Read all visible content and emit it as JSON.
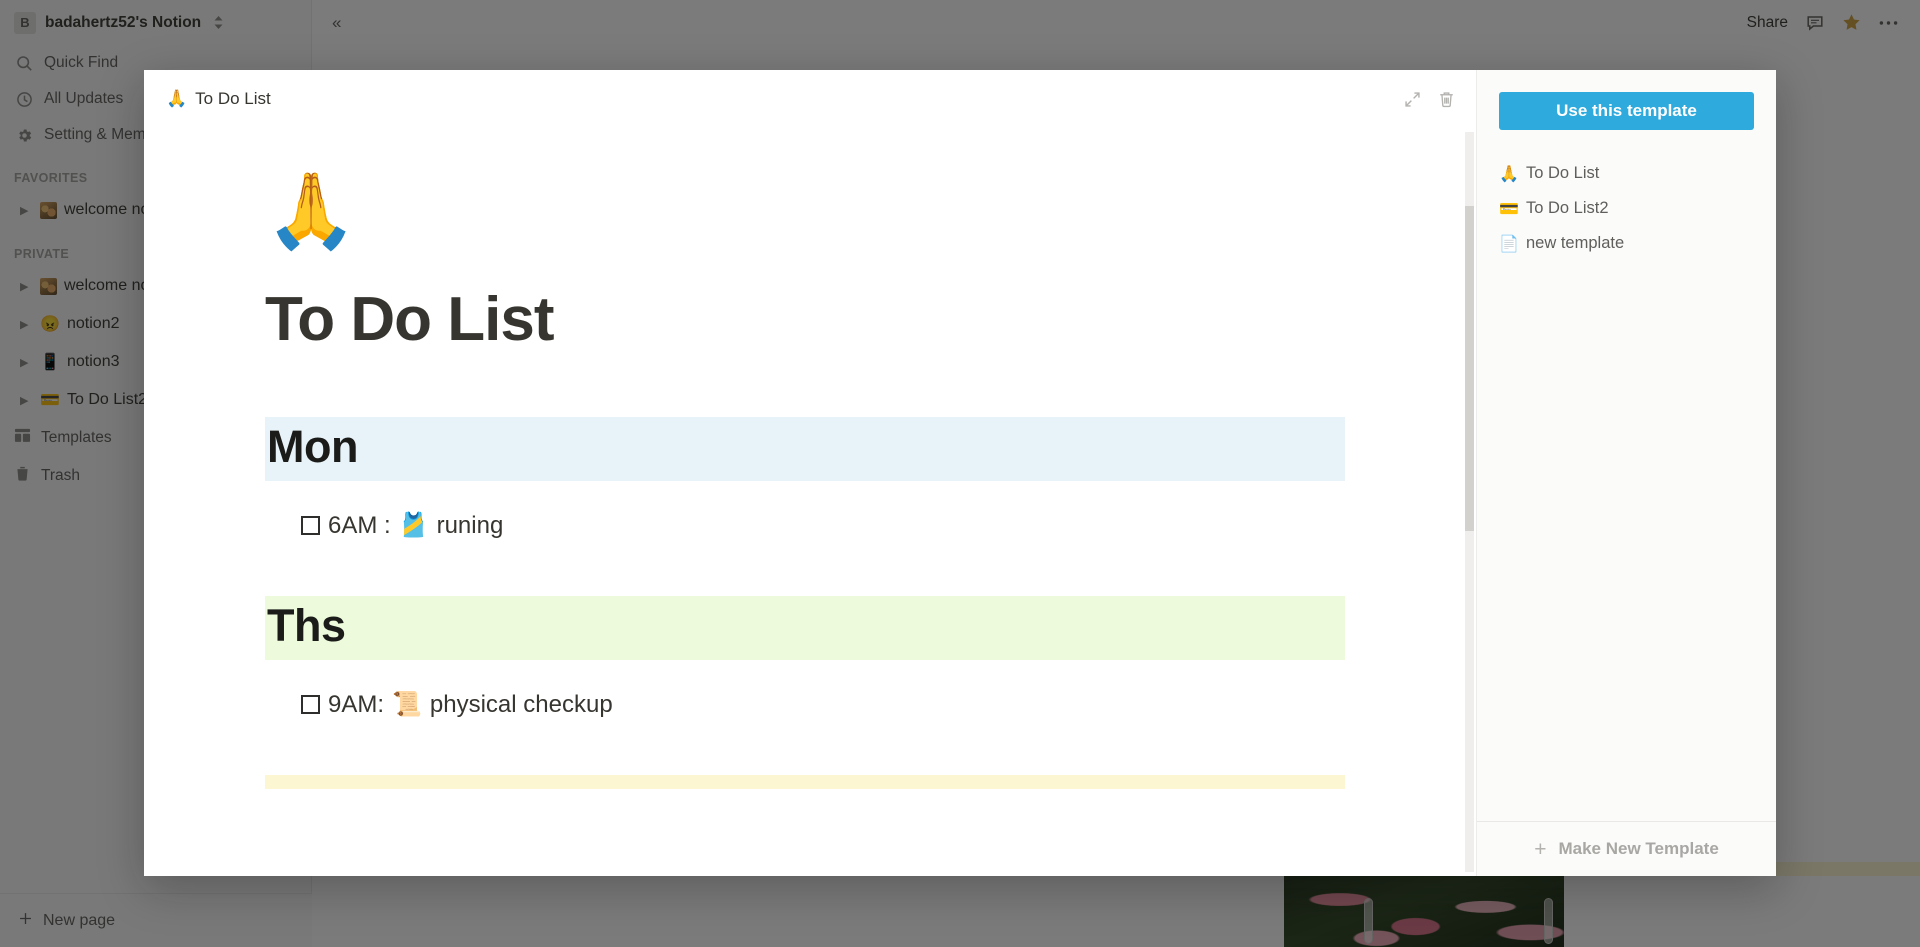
{
  "workspace": {
    "initial": "B",
    "name": "badahertz52's Notion",
    "switch_icon": "chevron-up-down-icon"
  },
  "sidebar": {
    "nav": [
      {
        "icon": "search-icon",
        "label": "Quick Find"
      },
      {
        "icon": "clock-icon",
        "label": "All Updates"
      },
      {
        "icon": "gear-icon",
        "label": "Setting & Members"
      }
    ],
    "favorites_label": "FAVORITES",
    "favorites": [
      {
        "icon": "image-thumbnail",
        "label": "welcome notion"
      }
    ],
    "private_label": "PRIVATE",
    "private": [
      {
        "icon": "image-thumbnail",
        "label": "welcome notion"
      },
      {
        "icon": "angry-face-emoji",
        "emoji": "😠",
        "label": "notion2"
      },
      {
        "icon": "mobile-phone-emoji",
        "emoji": "📱",
        "label": "notion3"
      },
      {
        "icon": "credit-card-emoji",
        "emoji": "💳",
        "label": "To Do List2"
      }
    ],
    "footer_items": [
      {
        "icon": "templates-icon",
        "label": "Templates"
      },
      {
        "icon": "trash-icon",
        "label": "Trash"
      }
    ],
    "new_page": {
      "icon": "plus-icon",
      "label": "New page"
    }
  },
  "topbar": {
    "collapse_icon": "double-chevron-left-icon",
    "share_label": "Share",
    "comment_icon": "comment-icon",
    "favorite_icon": "star-icon",
    "more_icon": "ellipsis-icon"
  },
  "modal": {
    "breadcrumb": {
      "emoji": "🙏",
      "label": "To Do List"
    },
    "expand_icon": "expand-diagonal-icon",
    "delete_icon": "trash-icon",
    "document": {
      "emoji": "🙏",
      "title": "To Do List",
      "sections": [
        {
          "day": "Mon",
          "band_color": "#e7f3f8",
          "items": [
            {
              "checked": false,
              "text": "6AM : ",
              "emoji": "🎽",
              "suffix": " runing"
            }
          ]
        },
        {
          "day": "Ths",
          "band_color": "#edfbdc",
          "items": [
            {
              "checked": false,
              "text": "9AM: ",
              "emoji": "📜",
              "suffix": " physical checkup"
            }
          ]
        }
      ]
    },
    "right_panel": {
      "use_template_label": "Use this template",
      "templates": [
        {
          "emoji": "🙏",
          "label": "To Do List"
        },
        {
          "emoji": "💳",
          "label": "To Do List2"
        },
        {
          "emoji": "📄",
          "label": "new template"
        }
      ],
      "make_new_label": "Make New Template",
      "make_new_icon": "plus-icon"
    }
  },
  "colors": {
    "accent_blue": "#2eaadc",
    "band_blue": "#e7f3f8",
    "band_green": "#edfbdc",
    "band_yellow": "#fdf6d3"
  }
}
